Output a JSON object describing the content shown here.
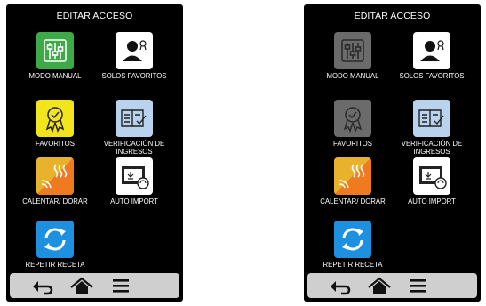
{
  "screens": [
    {
      "title": "EDITAR ACCESO",
      "tiles": [
        {
          "label": "MODO MANUAL",
          "icon": "sliders-icon",
          "color": "#3daa47",
          "state": "enabled"
        },
        {
          "label": "SOLOS FAVORITOS",
          "icon": "user-star-icon",
          "color": "#ffffff",
          "state": "enabled"
        },
        {
          "label": "FAVORITOS",
          "icon": "award-ribbon-icon",
          "color": "#f2e51d",
          "state": "enabled"
        },
        {
          "label": "VERIFICACIÓN DE INGRESOS",
          "icon": "book-check-icon",
          "color": "#b9d3ef",
          "state": "enabled"
        },
        {
          "label": "CALENTAR/ DORAR",
          "icon": "heat-waves-icon",
          "color": "#f08c2a",
          "state": "enabled"
        },
        {
          "label": "AUTO IMPORT",
          "icon": "import-sync-icon",
          "color": "#ffffff",
          "state": "enabled"
        },
        {
          "label": "REPETIR RECETA",
          "icon": "repeat-arrows-icon",
          "color": "#1e90e0",
          "state": "enabled"
        }
      ]
    },
    {
      "title": "EDITAR ACCESO",
      "tiles": [
        {
          "label": "MODO MANUAL",
          "icon": "sliders-icon",
          "color": "#6b6b6b",
          "state": "disabled"
        },
        {
          "label": "SOLOS FAVORITOS",
          "icon": "user-star-icon",
          "color": "#ffffff",
          "state": "enabled"
        },
        {
          "label": "FAVORITOS",
          "icon": "award-ribbon-icon",
          "color": "#6b6b6b",
          "state": "disabled"
        },
        {
          "label": "VERIFICACIÓN DE INGRESOS",
          "icon": "book-check-icon",
          "color": "#b9d3ef",
          "state": "enabled"
        },
        {
          "label": "CALENTAR/ DORAR",
          "icon": "heat-waves-icon",
          "color": "#f08c2a",
          "state": "enabled"
        },
        {
          "label": "AUTO IMPORT",
          "icon": "import-sync-icon",
          "color": "#ffffff",
          "state": "enabled"
        },
        {
          "label": "REPETIR RECETA",
          "icon": "repeat-arrows-icon",
          "color": "#1e90e0",
          "state": "enabled"
        }
      ]
    }
  ],
  "navbar": {
    "buttons": [
      {
        "icon": "back-arrow-icon"
      },
      {
        "icon": "home-icon"
      },
      {
        "icon": "menu-icon"
      }
    ]
  }
}
